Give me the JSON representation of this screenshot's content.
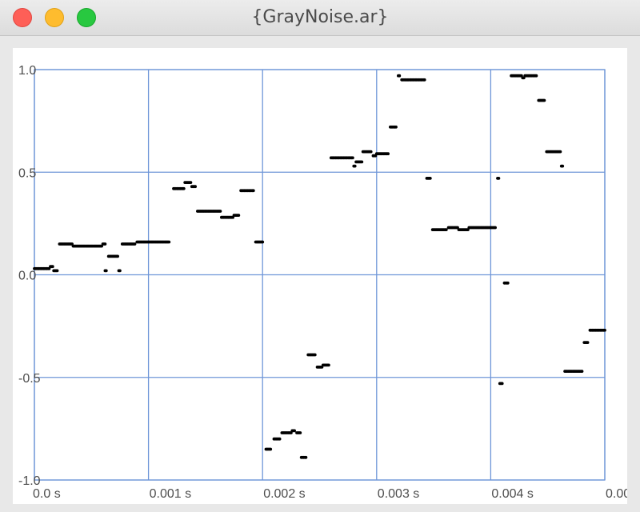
{
  "window": {
    "title": "{GrayNoise.ar}"
  },
  "chart_data": {
    "type": "scatter",
    "title": "",
    "xlabel": "",
    "ylabel": "",
    "xlim": [
      0,
      0.005
    ],
    "ylim": [
      -1.0,
      1.0
    ],
    "grid": true,
    "x_tick_labels": [
      "0.0 s",
      "0.001 s",
      "0.002 s",
      "0.003 s",
      "0.004 s",
      "0.00"
    ],
    "x_tick_values": [
      0,
      0.001,
      0.002,
      0.003,
      0.004,
      0.005
    ],
    "y_tick_labels": [
      "1.0",
      "0.5",
      "0.0",
      "-0.5",
      "-1.0"
    ],
    "y_tick_values": [
      1.0,
      0.5,
      0.0,
      -0.5,
      -1.0
    ],
    "point_color": "#000000",
    "grid_color": "#6f96d8",
    "series": [
      {
        "segments": [
          {
            "x0": 0.0,
            "x1": 0.00013,
            "y": 0.03
          },
          {
            "x0": 0.00014,
            "x1": 0.00016,
            "y": 0.04
          },
          {
            "x0": 0.00017,
            "x1": 0.0002,
            "y": 0.02
          },
          {
            "x0": 0.00022,
            "x1": 0.00033,
            "y": 0.15
          },
          {
            "x0": 0.00034,
            "x1": 0.00059,
            "y": 0.14
          },
          {
            "x0": 0.0006,
            "x1": 0.00062,
            "y": 0.15
          },
          {
            "x0": 0.00062,
            "x1": 0.00063,
            "y": 0.02
          },
          {
            "x0": 0.00065,
            "x1": 0.00073,
            "y": 0.09
          },
          {
            "x0": 0.00074,
            "x1": 0.00075,
            "y": 0.02
          },
          {
            "x0": 0.00077,
            "x1": 0.00088,
            "y": 0.15
          },
          {
            "x0": 0.0009,
            "x1": 0.00118,
            "y": 0.16
          },
          {
            "x0": 0.00122,
            "x1": 0.00131,
            "y": 0.42
          },
          {
            "x0": 0.00132,
            "x1": 0.00137,
            "y": 0.45
          },
          {
            "x0": 0.00138,
            "x1": 0.00141,
            "y": 0.43
          },
          {
            "x0": 0.00143,
            "x1": 0.00163,
            "y": 0.31
          },
          {
            "x0": 0.00164,
            "x1": 0.00174,
            "y": 0.28
          },
          {
            "x0": 0.00175,
            "x1": 0.00179,
            "y": 0.29
          },
          {
            "x0": 0.00181,
            "x1": 0.00192,
            "y": 0.41
          },
          {
            "x0": 0.00194,
            "x1": 0.002,
            "y": 0.16
          },
          {
            "x0": 0.00203,
            "x1": 0.00207,
            "y": -0.85
          },
          {
            "x0": 0.0021,
            "x1": 0.00215,
            "y": -0.8
          },
          {
            "x0": 0.00217,
            "x1": 0.00225,
            "y": -0.77
          },
          {
            "x0": 0.00226,
            "x1": 0.00228,
            "y": -0.76
          },
          {
            "x0": 0.0023,
            "x1": 0.00233,
            "y": -0.77
          },
          {
            "x0": 0.00234,
            "x1": 0.00238,
            "y": -0.89
          },
          {
            "x0": 0.0024,
            "x1": 0.00246,
            "y": -0.39
          },
          {
            "x0": 0.00248,
            "x1": 0.00252,
            "y": -0.45
          },
          {
            "x0": 0.00253,
            "x1": 0.00258,
            "y": -0.44
          },
          {
            "x0": 0.0026,
            "x1": 0.00279,
            "y": 0.57
          },
          {
            "x0": 0.0028,
            "x1": 0.00281,
            "y": 0.53
          },
          {
            "x0": 0.00282,
            "x1": 0.00287,
            "y": 0.55
          },
          {
            "x0": 0.00288,
            "x1": 0.00295,
            "y": 0.6
          },
          {
            "x0": 0.00297,
            "x1": 0.00299,
            "y": 0.58
          },
          {
            "x0": 0.003,
            "x1": 0.0031,
            "y": 0.59
          },
          {
            "x0": 0.00312,
            "x1": 0.00317,
            "y": 0.72
          },
          {
            "x0": 0.00319,
            "x1": 0.0032,
            "y": 0.97
          },
          {
            "x0": 0.00322,
            "x1": 0.00342,
            "y": 0.95
          },
          {
            "x0": 0.00344,
            "x1": 0.00347,
            "y": 0.47
          },
          {
            "x0": 0.00349,
            "x1": 0.00361,
            "y": 0.22
          },
          {
            "x0": 0.00363,
            "x1": 0.00371,
            "y": 0.23
          },
          {
            "x0": 0.00372,
            "x1": 0.0038,
            "y": 0.22
          },
          {
            "x0": 0.00381,
            "x1": 0.00404,
            "y": 0.23
          },
          {
            "x0": 0.00406,
            "x1": 0.00407,
            "y": 0.47
          },
          {
            "x0": 0.00408,
            "x1": 0.0041,
            "y": -0.53
          },
          {
            "x0": 0.00412,
            "x1": 0.00415,
            "y": -0.04
          },
          {
            "x0": 0.00418,
            "x1": 0.00427,
            "y": 0.97
          },
          {
            "x0": 0.00428,
            "x1": 0.00429,
            "y": 0.96
          },
          {
            "x0": 0.0043,
            "x1": 0.0044,
            "y": 0.97
          },
          {
            "x0": 0.00442,
            "x1": 0.00447,
            "y": 0.85
          },
          {
            "x0": 0.00449,
            "x1": 0.00461,
            "y": 0.6
          },
          {
            "x0": 0.00462,
            "x1": 0.00463,
            "y": 0.53
          },
          {
            "x0": 0.00465,
            "x1": 0.0048,
            "y": -0.47
          },
          {
            "x0": 0.00482,
            "x1": 0.00485,
            "y": -0.33
          },
          {
            "x0": 0.00487,
            "x1": 0.005,
            "y": -0.27
          }
        ],
        "step": 1e-05
      }
    ]
  }
}
